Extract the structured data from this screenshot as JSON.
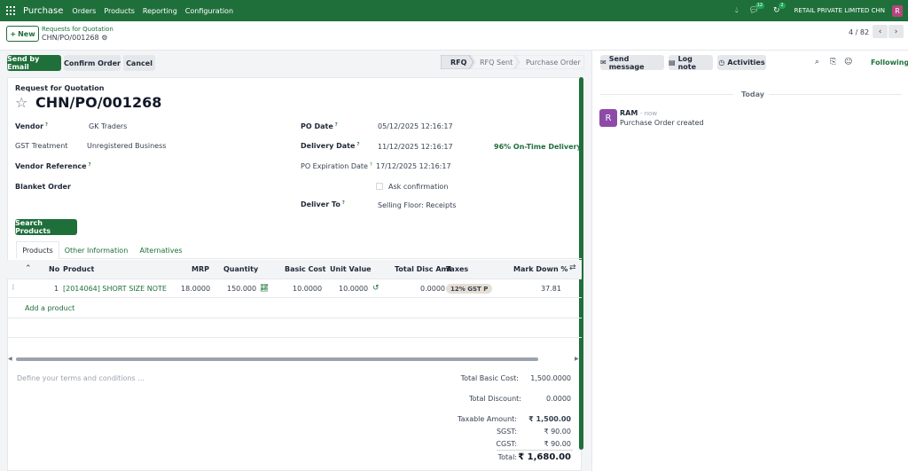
{
  "nav": {
    "app": "Purchase",
    "menus": [
      "Orders",
      "Products",
      "Reporting",
      "Configuration"
    ],
    "chat_count": "12",
    "activity_count": "2",
    "company": "RETAIL PRIVATE LIMITED CHN",
    "avatar_letter": "R"
  },
  "control": {
    "new_label": "New",
    "breadcrumb_parent": "Requests for Quotation",
    "breadcrumb_current": "CHN/PO/001268",
    "pager": "4 / 82"
  },
  "buttons": {
    "send_email": "Send by Email",
    "confirm": "Confirm Order",
    "cancel": "Cancel"
  },
  "statusbar": {
    "steps": [
      "RFQ",
      "RFQ Sent",
      "Purchase Order"
    ],
    "active": "RFQ"
  },
  "form": {
    "subtitle": "Request for Quotation",
    "title": "CHN/PO/001268",
    "vendor_label": "Vendor",
    "vendor": "GK Traders",
    "gst_label": "GST Treatment",
    "gst": "Unregistered Business",
    "vendor_ref_label": "Vendor Reference",
    "blanket_label": "Blanket Order",
    "po_date_label": "PO Date",
    "po_date": "05/12/2025 12:16:17",
    "delivery_label": "Delivery Date",
    "delivery": "11/12/2025 12:16:17",
    "on_time": "96% On-Time Delivery",
    "expiry_label": "PO Expiration Date",
    "expiry": "17/12/2025 12:16:17",
    "ask_confirmation": "Ask confirmation",
    "deliver_to_label": "Deliver To",
    "deliver_to": "Selling Floor: Receipts",
    "search_products": "Search Products"
  },
  "tabs": [
    "Products",
    "Other Information",
    "Alternatives"
  ],
  "table": {
    "headers": [
      "No",
      "Product",
      "MRP",
      "Quantity",
      "Basic Cost",
      "Unit Value",
      "Total Disc Amt",
      "Taxes",
      "Mark Down %"
    ],
    "rows": [
      {
        "no": "1",
        "product": "[2014064] SHORT SIZE NOTE",
        "mrp": "18.0000",
        "qty": "150.000",
        "basic_cost": "10.0000",
        "unit_value": "10.0000",
        "disc": "0.0000",
        "tax": "12% GST P",
        "markdown": "37.81"
      }
    ],
    "add_product": "Add a product"
  },
  "terms_placeholder": "Define your terms and conditions ...",
  "totals": {
    "basic_cost_label": "Total Basic Cost:",
    "basic_cost": "1,500.0000",
    "discount_label": "Total Discount:",
    "discount": "0.0000",
    "taxable_label": "Taxable Amount:",
    "taxable": "₹ 1,500.00",
    "sgst_label": "SGST:",
    "sgst": "₹ 90.00",
    "cgst_label": "CGST:",
    "cgst": "₹ 90.00",
    "total_label": "Total:",
    "total": "₹ 1,680.00"
  },
  "chatter": {
    "send_message": "Send message",
    "log_note": "Log note",
    "activities": "Activities",
    "following": "Following",
    "today": "Today",
    "author": "RAM",
    "time": "- now",
    "avatar_letter": "R",
    "message": "Purchase Order created"
  },
  "colors": {
    "brand": "#1f6f3b",
    "avatar": "#b5457f",
    "chatter_avatar": "#8e4aa8"
  }
}
